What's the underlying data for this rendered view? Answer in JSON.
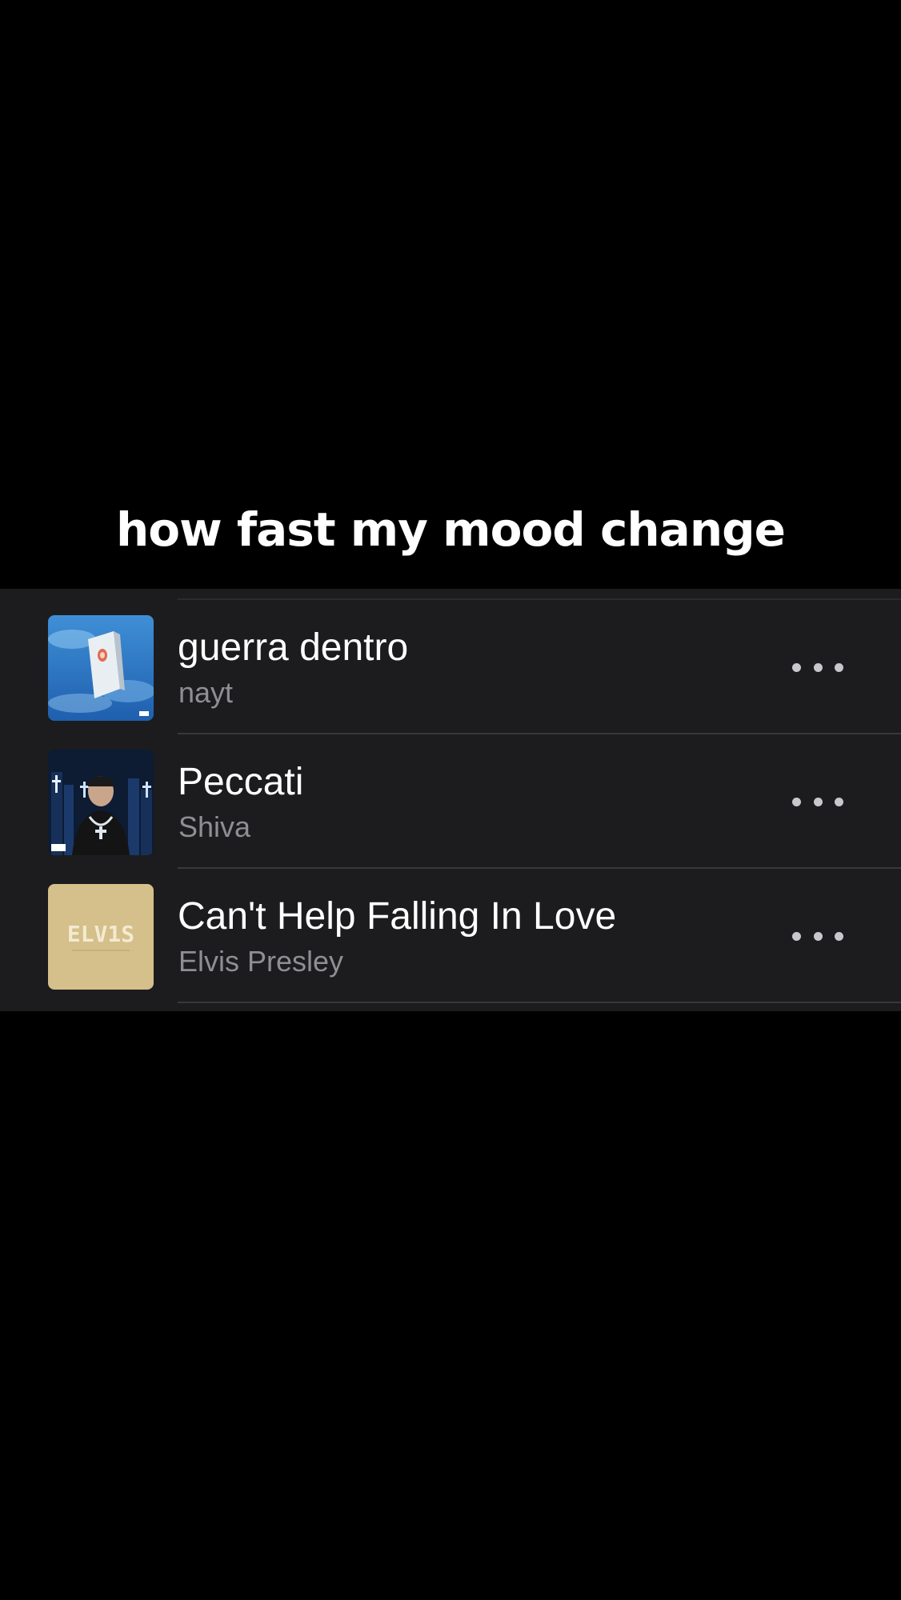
{
  "caption": "how fast my mood change",
  "songs": [
    {
      "title": "guerra dentro",
      "artist": "nayt",
      "artwork": "blue-sky-coffin-artwork",
      "more_icon": "ellipsis-icon"
    },
    {
      "title": "Peccati",
      "artist": "Shiva",
      "artwork": "night-city-portrait-artwork",
      "more_icon": "ellipsis-icon"
    },
    {
      "title": "Can't Help Falling In Love",
      "artist": "Elvis Presley",
      "artwork": "gold-elvis-logo-artwork",
      "more_icon": "ellipsis-icon",
      "artwork_text": "ELV1S"
    }
  ],
  "colors": {
    "background": "#000000",
    "panel": "#1c1c1e",
    "title_text": "#ffffff",
    "artist_text": "#8e8e93",
    "separator": "#38383a"
  }
}
